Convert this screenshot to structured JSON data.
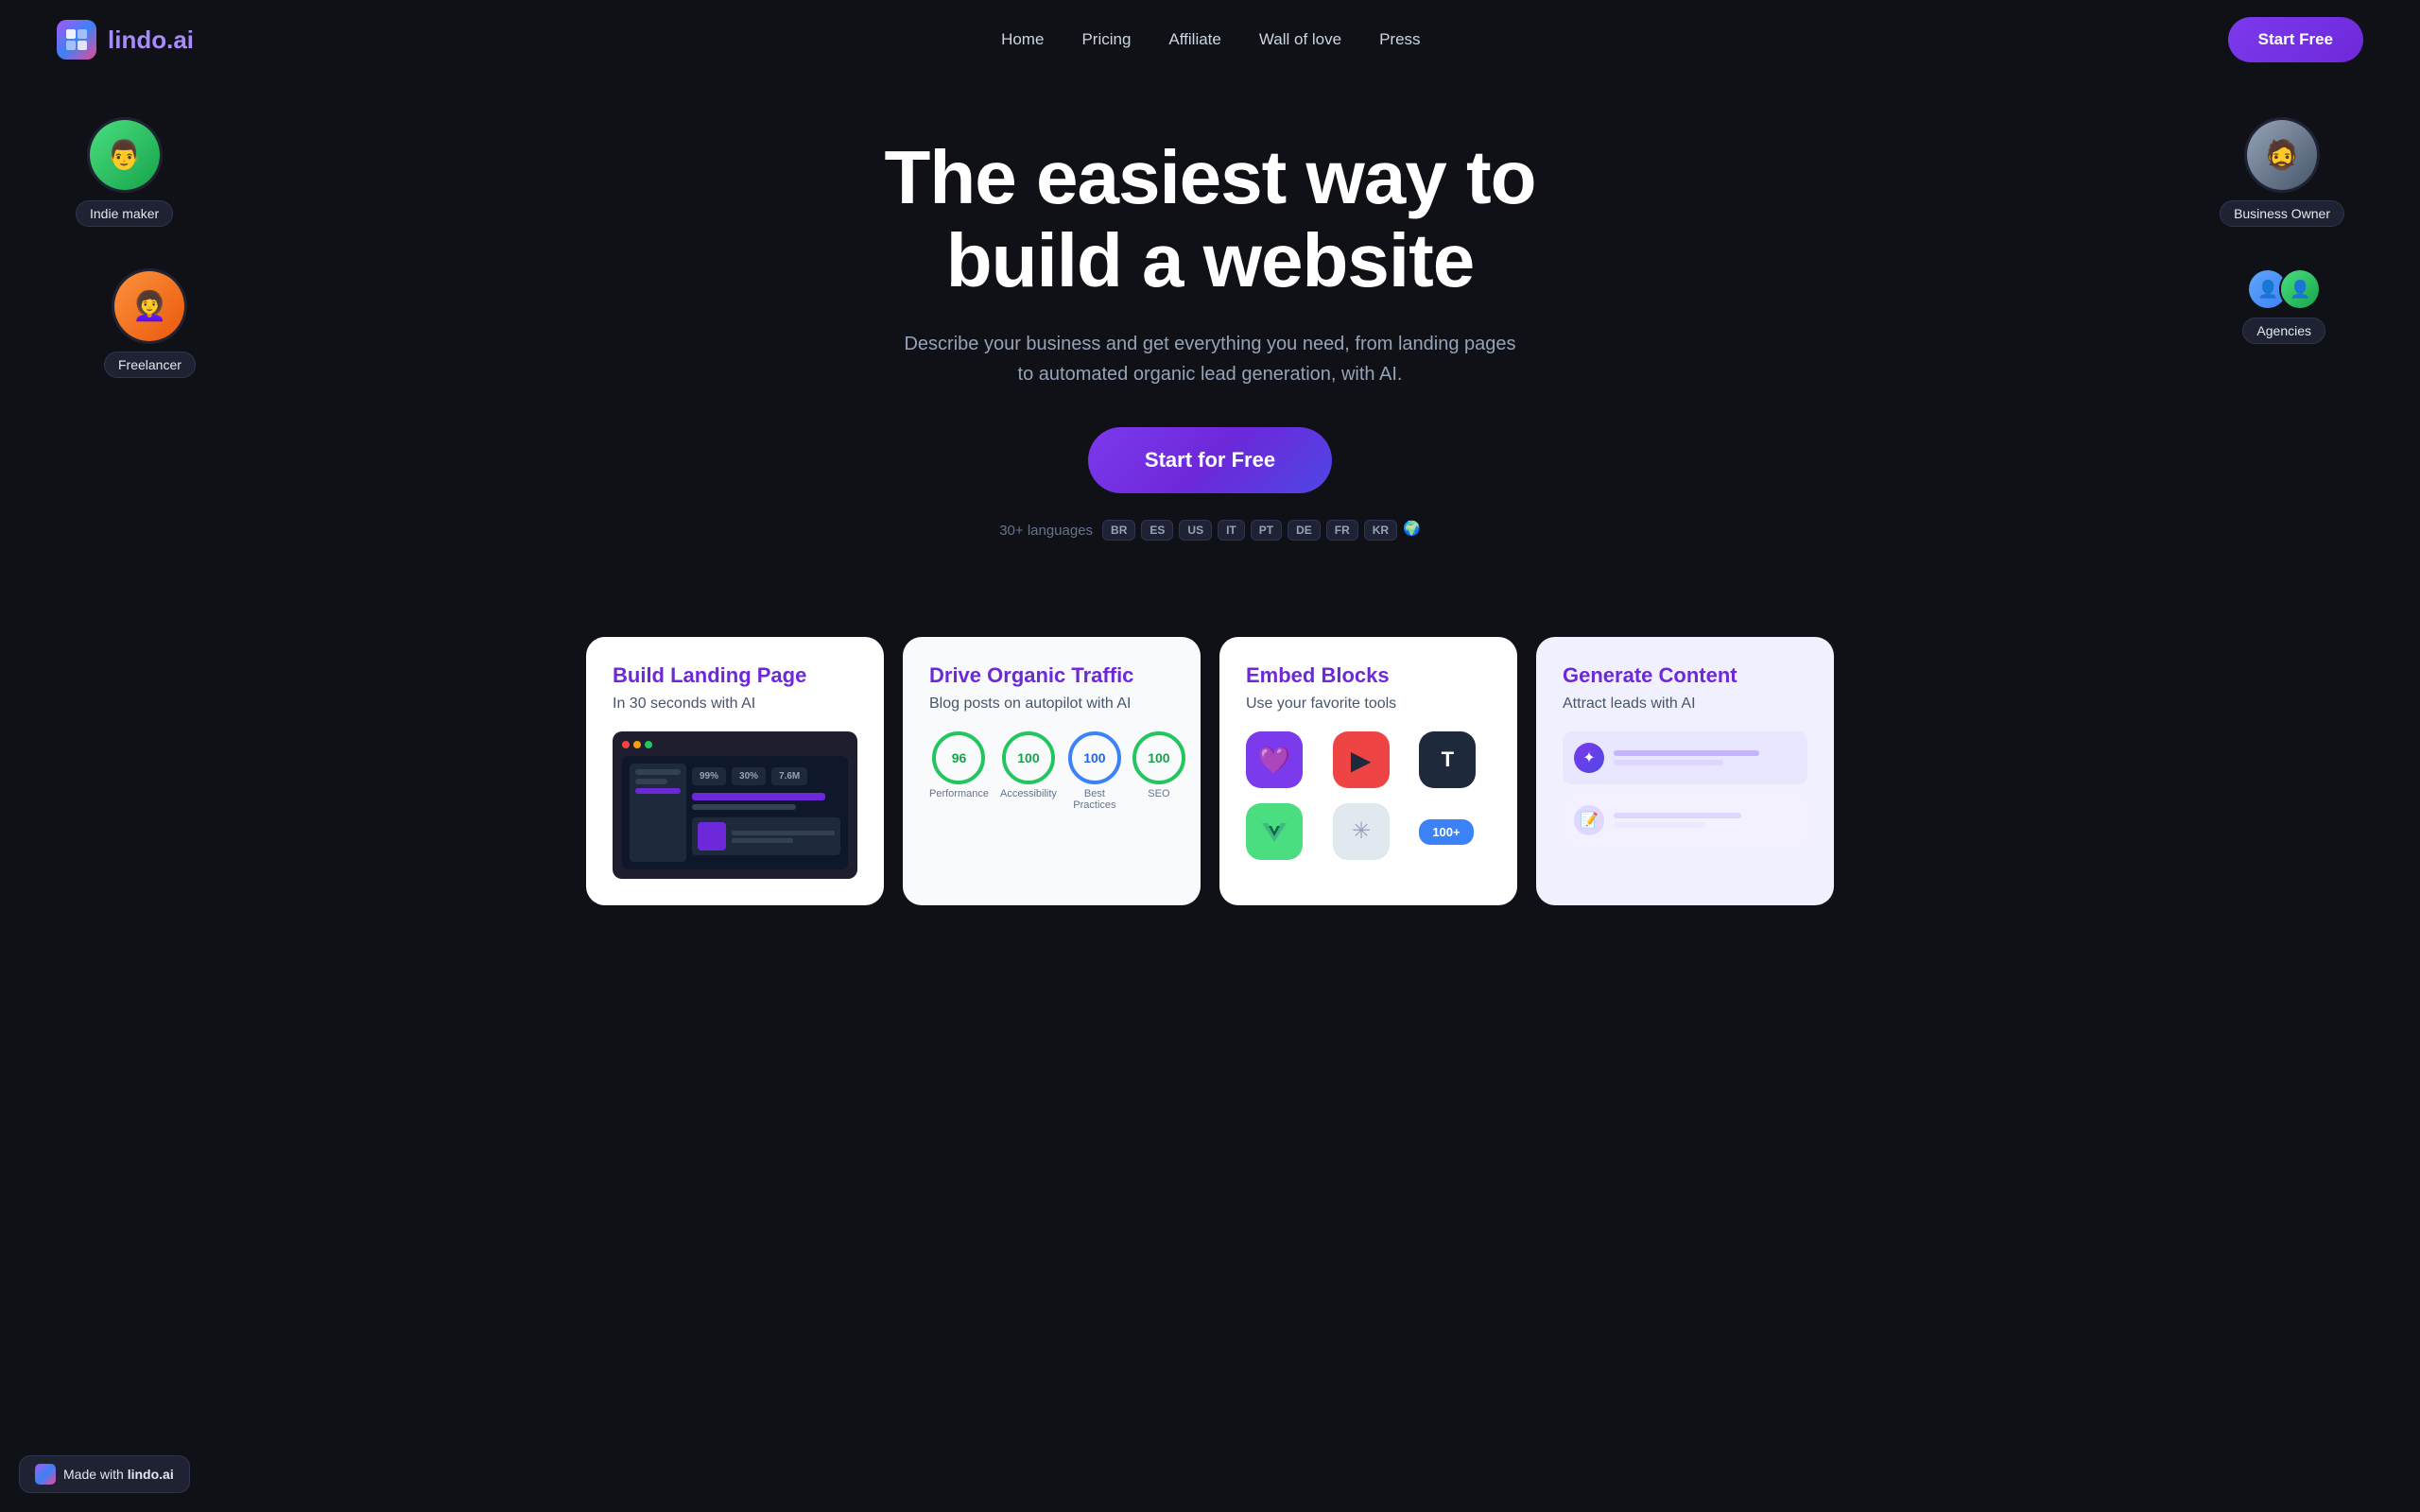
{
  "nav": {
    "logo_text_main": "lindo",
    "logo_text_suffix": ".ai",
    "links": [
      {
        "label": "Home",
        "id": "home"
      },
      {
        "label": "Pricing",
        "id": "pricing"
      },
      {
        "label": "Affiliate",
        "id": "affiliate"
      },
      {
        "label": "Wall of love",
        "id": "wall-of-love"
      },
      {
        "label": "Press",
        "id": "press"
      }
    ],
    "cta_label": "Start Free"
  },
  "hero": {
    "headline_line1": "The easiest way to",
    "headline_line2": "build a website",
    "subtext": "Describe your business and get everything you need, from landing pages to automated organic lead generation, with AI.",
    "cta_label": "Start for Free",
    "languages_prefix": "30+ languages",
    "lang_tags": [
      "BR",
      "ES",
      "US",
      "IT",
      "PT",
      "DE",
      "FR",
      "KR"
    ]
  },
  "avatars": [
    {
      "id": "indie-maker",
      "label": "Indie maker",
      "position": "top-left"
    },
    {
      "id": "freelancer",
      "label": "Freelancer",
      "position": "mid-left"
    },
    {
      "id": "business-owner",
      "label": "Business Owner",
      "position": "top-right"
    },
    {
      "id": "agencies",
      "label": "Agencies",
      "position": "mid-right"
    }
  ],
  "cards": [
    {
      "id": "build-landing",
      "title": "Build Landing Page",
      "subtitle": "In 30 seconds with AI"
    },
    {
      "id": "drive-traffic",
      "title": "Drive Organic Traffic",
      "subtitle": "Blog posts on autopilot with AI",
      "scores": [
        {
          "value": "96",
          "label": "Performance"
        },
        {
          "value": "100",
          "label": "Accessibility"
        },
        {
          "value": "100",
          "label": "Best Practices"
        },
        {
          "value": "100",
          "label": "SEO"
        }
      ]
    },
    {
      "id": "embed-blocks",
      "title": "Embed Blocks",
      "subtitle": "Use your favorite tools",
      "count_label": "100+"
    },
    {
      "id": "generate-content",
      "title": "Generate Content",
      "subtitle": "Attract leads with AI"
    }
  ],
  "made_with": {
    "label": "Made with",
    "brand": "lindo.ai"
  }
}
